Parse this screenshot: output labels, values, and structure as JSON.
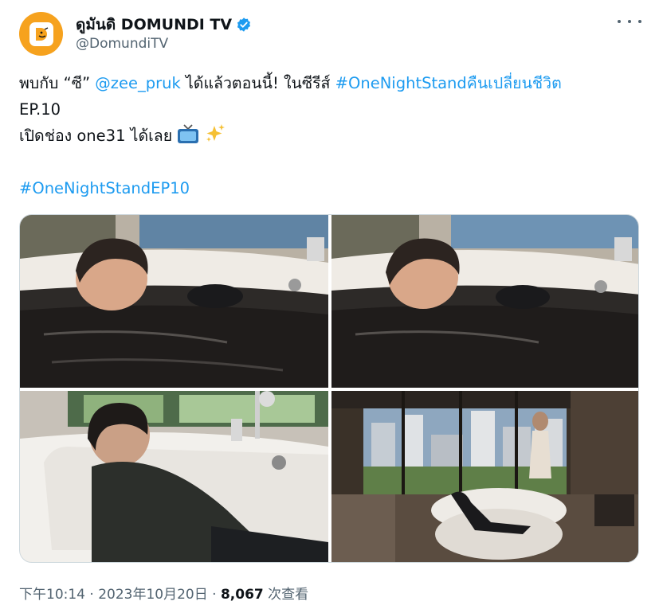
{
  "author": {
    "display_name": "ดูมันดิ DOMUNDI TV",
    "handle": "@DomundiTV",
    "avatar_icon": "domundi-logo-icon",
    "avatar_color": "#f6a21e",
    "verified_icon": "verified-badge-icon",
    "verified_color": "#1d9bf0"
  },
  "more_icon": "more-options-icon",
  "tweet": {
    "line1_prefix": "พบกับ “ซี” ",
    "mention": "@zee_pruk",
    "line1_middle": " ได้แล้วตอนนี้! ในซีรีส์ ",
    "hashtag1": "#OneNightStandคืนเปลี่ยนชีวิต",
    "line2": "EP.10",
    "line3": "เปิดช่อง one31 ได้เลย",
    "emoji_tv": "television-icon",
    "emoji_sparkles": "sparkles-icon",
    "hashtag2": "#OneNightStandEP10",
    "link_color": "#1d9bf0"
  },
  "media": {
    "photos": [
      {
        "name": "bathtub-submerged-photo-1"
      },
      {
        "name": "bathtub-submerged-photo-2"
      },
      {
        "name": "bathtub-reclining-photo"
      },
      {
        "name": "bathroom-window-scene-photo"
      }
    ]
  },
  "footer": {
    "time": "下午10:14",
    "separator": " · ",
    "date": "2023年10月20日",
    "views_count": "8,067",
    "views_label": " 次查看"
  }
}
